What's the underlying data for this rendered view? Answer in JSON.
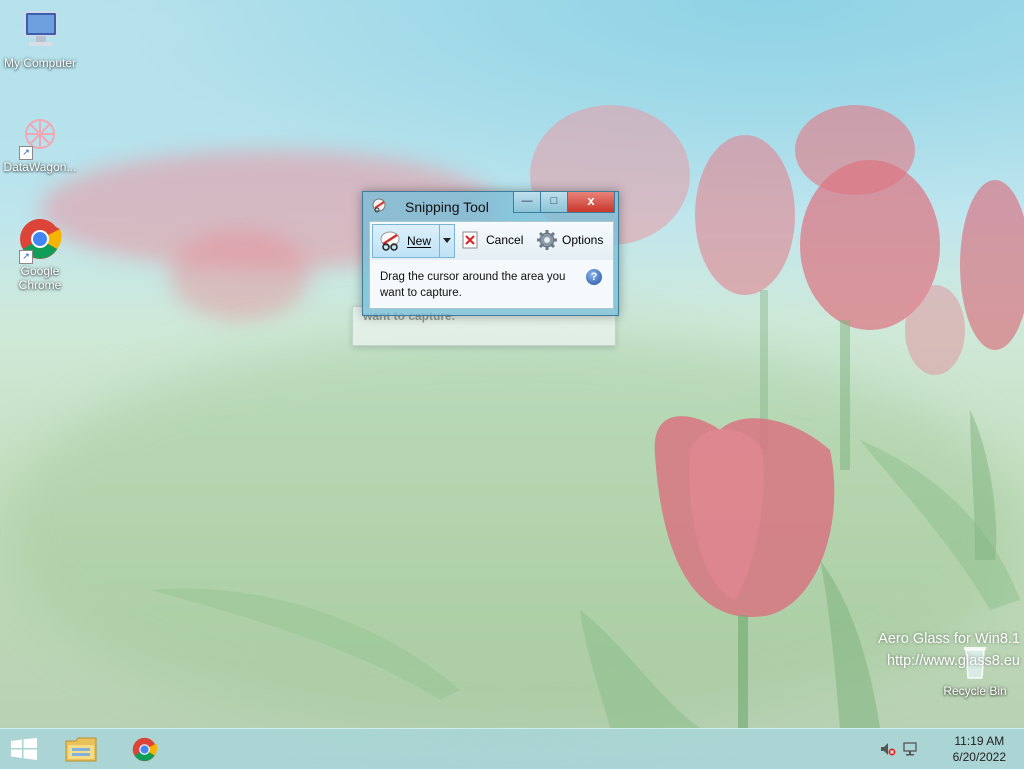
{
  "desktop": {
    "icons": [
      {
        "label": "My Computer"
      },
      {
        "label": "DataWagon..."
      },
      {
        "label": "Google Chrome"
      },
      {
        "label": "Recycle Bin"
      }
    ]
  },
  "snipping_tool": {
    "title": "Snipping Tool",
    "ghost_text": "want to capture.",
    "toolbar": {
      "new_label": "New",
      "cancel_label": "Cancel",
      "options_label": "Options"
    },
    "message": "Drag the cursor around the area you want to capture.",
    "help_glyph": "?",
    "close_glyph": "x"
  },
  "watermark": {
    "line1": "Aero Glass for Win8.1",
    "line2": "http://www.glass8.eu"
  },
  "taskbar": {
    "pinned": [
      "start-button",
      "file-explorer-icon",
      "chrome-icon"
    ],
    "clock": {
      "time": "11:19 AM",
      "date": "6/20/2022"
    }
  },
  "colors": {
    "window_frame": "#78bed7",
    "close_button": "#c8362a",
    "taskbar": "#a5d7e1"
  }
}
